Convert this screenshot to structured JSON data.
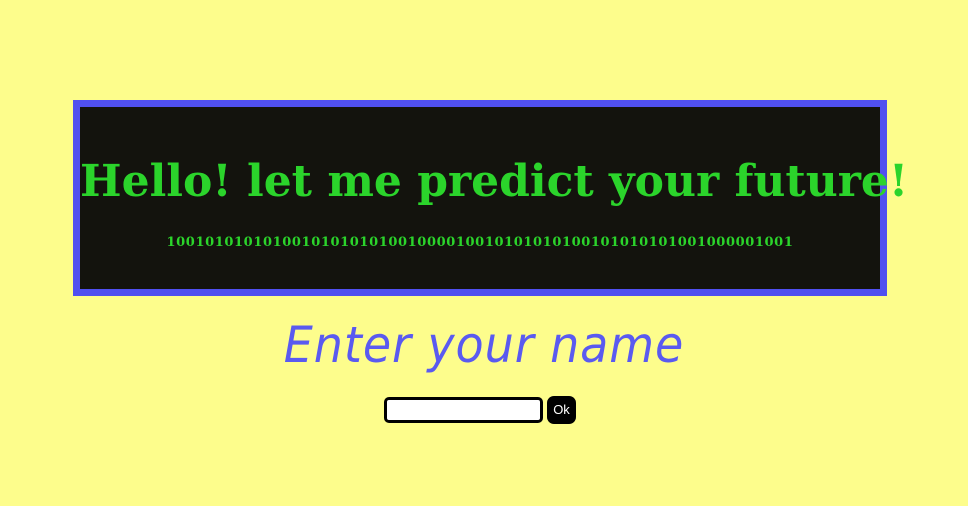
{
  "banner": {
    "title": "Hello! let me predict your future!",
    "binary": "10010101010100101010101001000010010101010100101010101001000001001"
  },
  "prompt": {
    "label": "Enter your name"
  },
  "form": {
    "name_value": "",
    "name_placeholder": "",
    "ok_label": "Ok"
  },
  "colors": {
    "background": "#fdfd8c",
    "banner_bg": "#13130d",
    "banner_border": "#5050f0",
    "banner_text": "#2bd42b",
    "prompt_text": "#5a5af0",
    "button_bg": "#000000",
    "button_text": "#ffffff"
  }
}
